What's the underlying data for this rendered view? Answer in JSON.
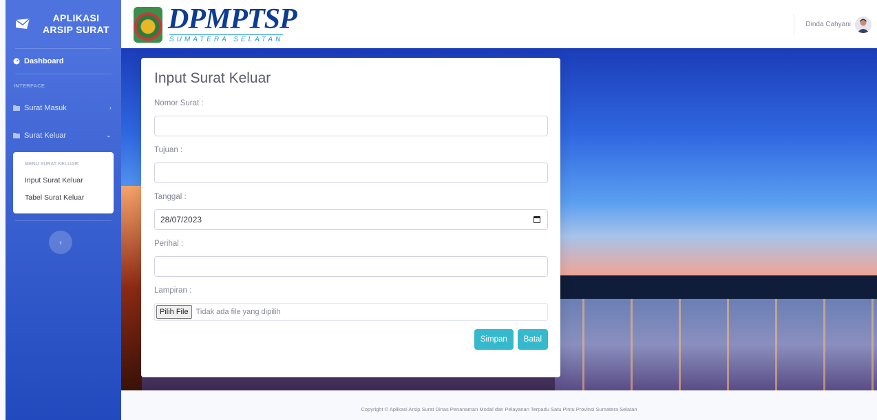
{
  "sidebar": {
    "brand_line1": "APLIKASI",
    "brand_line2": "ARSIP SURAT",
    "dashboard": "Dashboard",
    "heading": "INTERFACE",
    "surat_masuk": "Surat Masuk",
    "surat_keluar": "Surat Keluar",
    "submenu_heading": "MENU SURAT KELUAR:",
    "submenu_items": [
      "Input Surat Keluar",
      "Tabel Surat Keluar"
    ],
    "toggle_symbol": "‹"
  },
  "topbar": {
    "logo_text": "DPMPTSP",
    "logo_subtext": "SUMATERA SELATAN",
    "user_name": "Dinda Cahyani"
  },
  "form": {
    "title": "Input Surat Keluar",
    "nomor_label": "Nomor Surat :",
    "nomor_value": "",
    "tujuan_label": "Tujuan :",
    "tujuan_value": "",
    "tanggal_label": "Tanggal :",
    "tanggal_value": "28/07/2023",
    "perihal_label": "Perihal :",
    "perihal_value": "",
    "lampiran_label": "Lampiran :",
    "file_button": "Pilih File",
    "file_status": "Tidak ada file yang dipilih",
    "save_label": "Simpan",
    "cancel_label": "Batal"
  },
  "footer": {
    "copyright": "Copyright © Aplikasi Arsip Surat Dinas Penanaman Modal dan Pelayanan Terpadu Satu Pintu Provinsi Sumatera Selatan"
  },
  "colors": {
    "sidebar": "#4e73df",
    "button": "#36b9cc",
    "logo": "#0d3c94"
  }
}
